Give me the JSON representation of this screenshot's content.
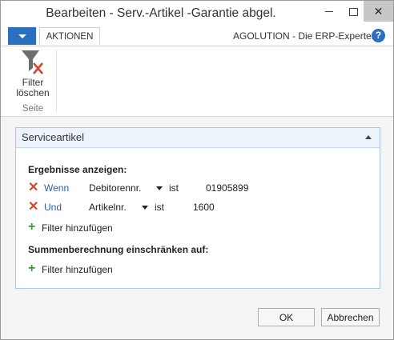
{
  "window": {
    "title": "Bearbeiten - Serv.-Artikel -Garantie abgel."
  },
  "ribbon": {
    "tab_label": "AKTIONEN",
    "brand_text": "AGOLUTION - Die ERP-Experten",
    "help_glyph": "?",
    "filter_clear": {
      "line1": "Filter",
      "line2": "löschen"
    },
    "group_name": "Seite"
  },
  "panel": {
    "title": "Serviceartikel",
    "results_heading": "Ergebnisse anzeigen:",
    "filters": [
      {
        "conj": "Wenn",
        "field": "Debitorennr.",
        "op": "ist",
        "value": "01905899"
      },
      {
        "conj": "Und",
        "field": "Artikelnr.",
        "op": "ist",
        "value": "1600"
      }
    ],
    "add_filter_label": "Filter hinzufügen",
    "sum_heading": "Summenberechnung einschränken auf:",
    "sum_add_filter_label": "Filter hinzufügen"
  },
  "buttons": {
    "ok": "OK",
    "cancel": "Abbrechen"
  },
  "colors": {
    "accent_blue": "#2a6fc0",
    "remove_red": "#d8452a",
    "add_green": "#3a9a3a",
    "link_blue": "#2a5fae"
  }
}
